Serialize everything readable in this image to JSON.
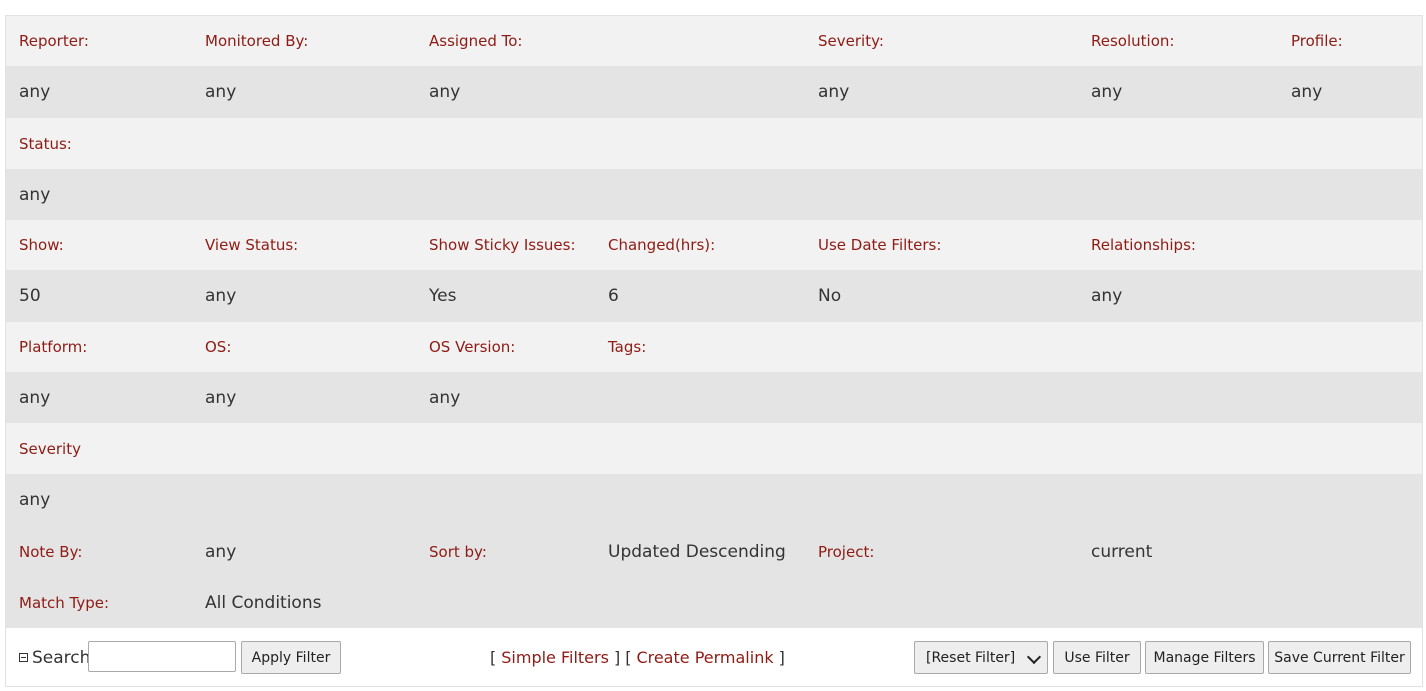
{
  "row1": {
    "labels": [
      "Reporter:",
      "Monitored By:",
      "Assigned To:",
      "Severity:",
      "Resolution:",
      "Profile:"
    ],
    "values": [
      "any",
      "any",
      "any",
      "any",
      "any",
      "any"
    ]
  },
  "row2": {
    "label": "Status:",
    "value": "any"
  },
  "row3": {
    "labels": [
      "Show:",
      "View Status:",
      "Show Sticky Issues:",
      "Changed(hrs):",
      "Use Date Filters:",
      "Relationships:"
    ],
    "values": [
      "50",
      "any",
      "Yes",
      "6",
      "No",
      "any"
    ]
  },
  "row4": {
    "labels": [
      "Platform:",
      "OS:",
      "OS Version:",
      "Tags:"
    ],
    "values": [
      "any",
      "any",
      "any"
    ]
  },
  "row5": {
    "label": "Severity",
    "value": "any"
  },
  "row6": {
    "note_by_label": "Note By:",
    "note_by_value": "any",
    "sort_by_label": "Sort by:",
    "sort_by_value": "Updated Descending",
    "project_label": "Project:",
    "project_value": "current"
  },
  "row7": {
    "match_type_label": "Match Type:",
    "match_type_value": "All Conditions"
  },
  "footer": {
    "search_label": "Search",
    "search_value": "",
    "apply_filter": "Apply Filter",
    "bracket_open": "[",
    "bracket_close": "]",
    "simple_filters": "Simple Filters",
    "create_permalink": "Create Permalink",
    "reset_filter_selected": "[Reset Filter]",
    "use_filter": "Use Filter",
    "manage_filters": "Manage Filters",
    "save_current_filter": "Save Current Filter"
  },
  "colors": {
    "label": "#8e1b14",
    "value": "#333333",
    "row_light": "#f2f2f2",
    "row_dark": "#e4e4e4"
  }
}
